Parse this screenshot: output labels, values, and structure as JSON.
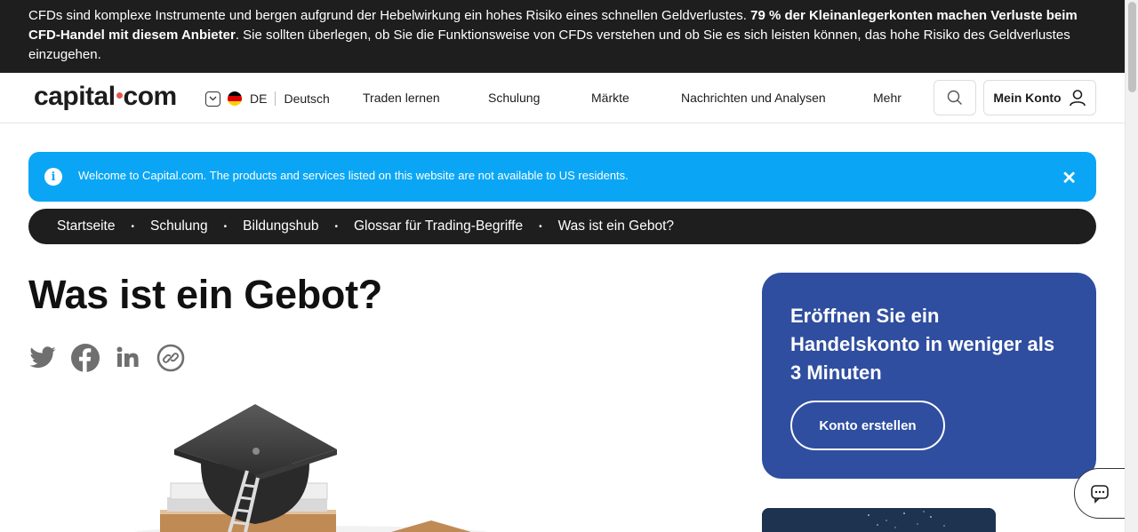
{
  "risk_warning": {
    "part1": "CFDs sind komplexe Instrumente und bergen aufgrund der Hebelwirkung ein hohes Risiko eines schnellen Geldverlustes. ",
    "bold": "79 % der Kleinanlegerkonten machen Verluste beim CFD-Handel mit diesem Anbieter",
    "part2": ". Sie sollten überlegen, ob Sie die Funktionsweise von CFDs verstehen und ob Sie es sich leisten können, das hohe Risiko des Geldverlustes einzugehen."
  },
  "header": {
    "logo_left": "capital",
    "logo_right": "com",
    "lang_code": "DE",
    "lang_name": "Deutsch",
    "nav": [
      "Traden lernen",
      "Schulung",
      "Märkte",
      "Nachrichten und Analysen",
      "Mehr"
    ],
    "account_label": "Mein Konto"
  },
  "notice": {
    "info_glyph": "i",
    "message": "Welcome to Capital.com. The products and services listed on this website are not available to US residents.",
    "close_glyph": "✕"
  },
  "breadcrumb": [
    "Startseite",
    "Schulung",
    "Bildungshub",
    "Glossar für Trading-Begriffe",
    "Was ist ein Gebot?"
  ],
  "breadcrumb_separator": "•",
  "page": {
    "title": "Was ist ein Gebot?",
    "share_icons": [
      "twitter-icon",
      "facebook-icon",
      "linkedin-icon",
      "copy-link-icon"
    ]
  },
  "promo": {
    "heading": "Eröffnen Sie ein Handelskonto in weniger als 3 Minuten",
    "button_label": "Konto erstellen"
  },
  "colors": {
    "risk_bar": "#1e1e1e",
    "notice_blue": "#0aa6f5",
    "promo_blue": "#2f4ea0",
    "logo_dot": "#e0584c"
  }
}
